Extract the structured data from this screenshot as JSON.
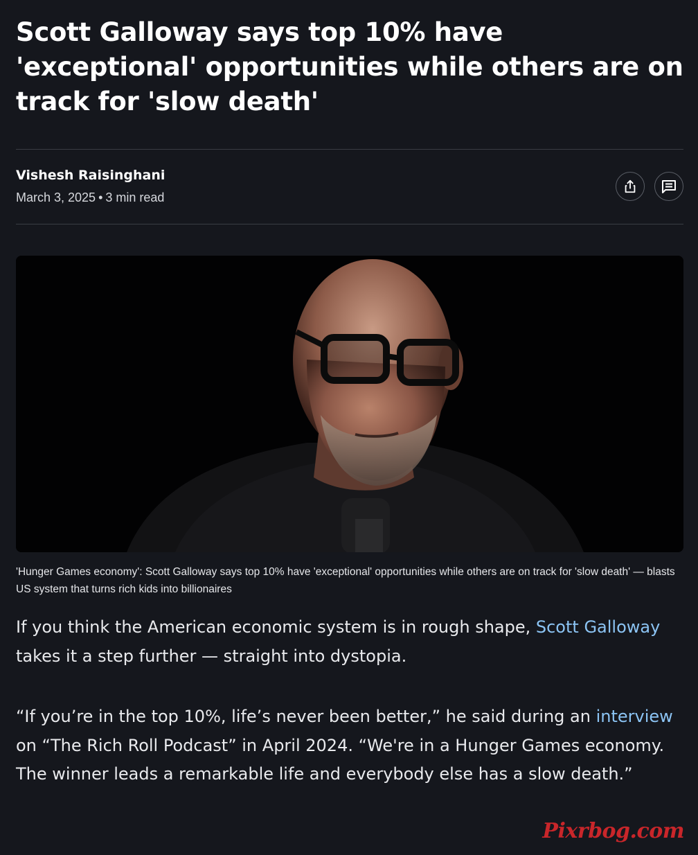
{
  "article": {
    "title": "Scott Galloway says top 10% have 'exceptional' opportunities while others are on track for 'slow death'",
    "author": "Vishesh Raisinghani",
    "date": "March 3, 2025",
    "separator": "•",
    "read_time": "3 min read",
    "actions": [
      {
        "name": "share",
        "icon": "share-icon"
      },
      {
        "name": "comments",
        "icon": "comment-icon"
      }
    ],
    "caption": "'Hunger Games economy': Scott Galloway says top 10% have 'exceptional' opportunities while others are on track for 'slow death' — blasts US system that turns rich kids into billionaires",
    "p1": {
      "before": "If you think the American economic system is in rough shape, ",
      "link": "Scott Galloway",
      "after": " takes it a step further — straight into dystopia."
    },
    "p2": {
      "before": "“If you’re in the top 10%, life’s never been better,” he said during an ",
      "link": "interview",
      "after": " on “The Rich Roll Podcast” in April 2024. “We're in a Hunger Games economy. The winner leads a remarkable life and everybody else has a slow death.”"
    }
  },
  "watermark": "Pixrbog.com",
  "colors": {
    "background": "#15171d",
    "link": "#8cc4f4",
    "watermark": "#c9262a"
  }
}
